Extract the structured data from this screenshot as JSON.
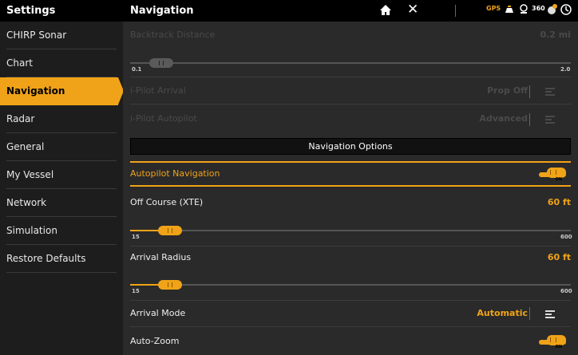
{
  "header": {
    "settings_title": "Settings",
    "page_title": "Navigation",
    "status": {
      "gps": "GPS",
      "temp": "360"
    }
  },
  "sidebar": {
    "items": [
      {
        "label": "CHIRP Sonar"
      },
      {
        "label": "Chart"
      },
      {
        "label": "Navigation",
        "active": true
      },
      {
        "label": "Radar"
      },
      {
        "label": "General"
      },
      {
        "label": "My Vessel"
      },
      {
        "label": "Network"
      },
      {
        "label": "Simulation"
      },
      {
        "label": "Restore Defaults"
      }
    ]
  },
  "main": {
    "backtrack": {
      "label": "Backtrack Distance",
      "value": "0.2 mi",
      "min": "0.1",
      "max": "2.0",
      "position": 0.02
    },
    "ipilot_arrival": {
      "label": "i-Pilot Arrival",
      "value": "Prop Off"
    },
    "ipilot_autopilot": {
      "label": "i-Pilot Autopilot",
      "value": "Advanced"
    },
    "section_banner": "Navigation Options",
    "autopilot_nav": {
      "label": "Autopilot Navigation",
      "state": "ON"
    },
    "off_course": {
      "label": "Off Course (XTE)",
      "value": "60 ft",
      "min": "15",
      "max": "600",
      "position": 0.077
    },
    "arrival_radius": {
      "label": "Arrival Radius",
      "value": "60 ft",
      "min": "15",
      "max": "600",
      "position": 0.077
    },
    "arrival_mode": {
      "label": "Arrival Mode",
      "value": "Automatic"
    },
    "auto_zoom": {
      "label": "Auto-Zoom",
      "state": "ON"
    }
  },
  "colors": {
    "accent": "#f0a318",
    "background": "#2a2a2a",
    "sidebar": "#1d1d1d",
    "header": "#000000"
  }
}
